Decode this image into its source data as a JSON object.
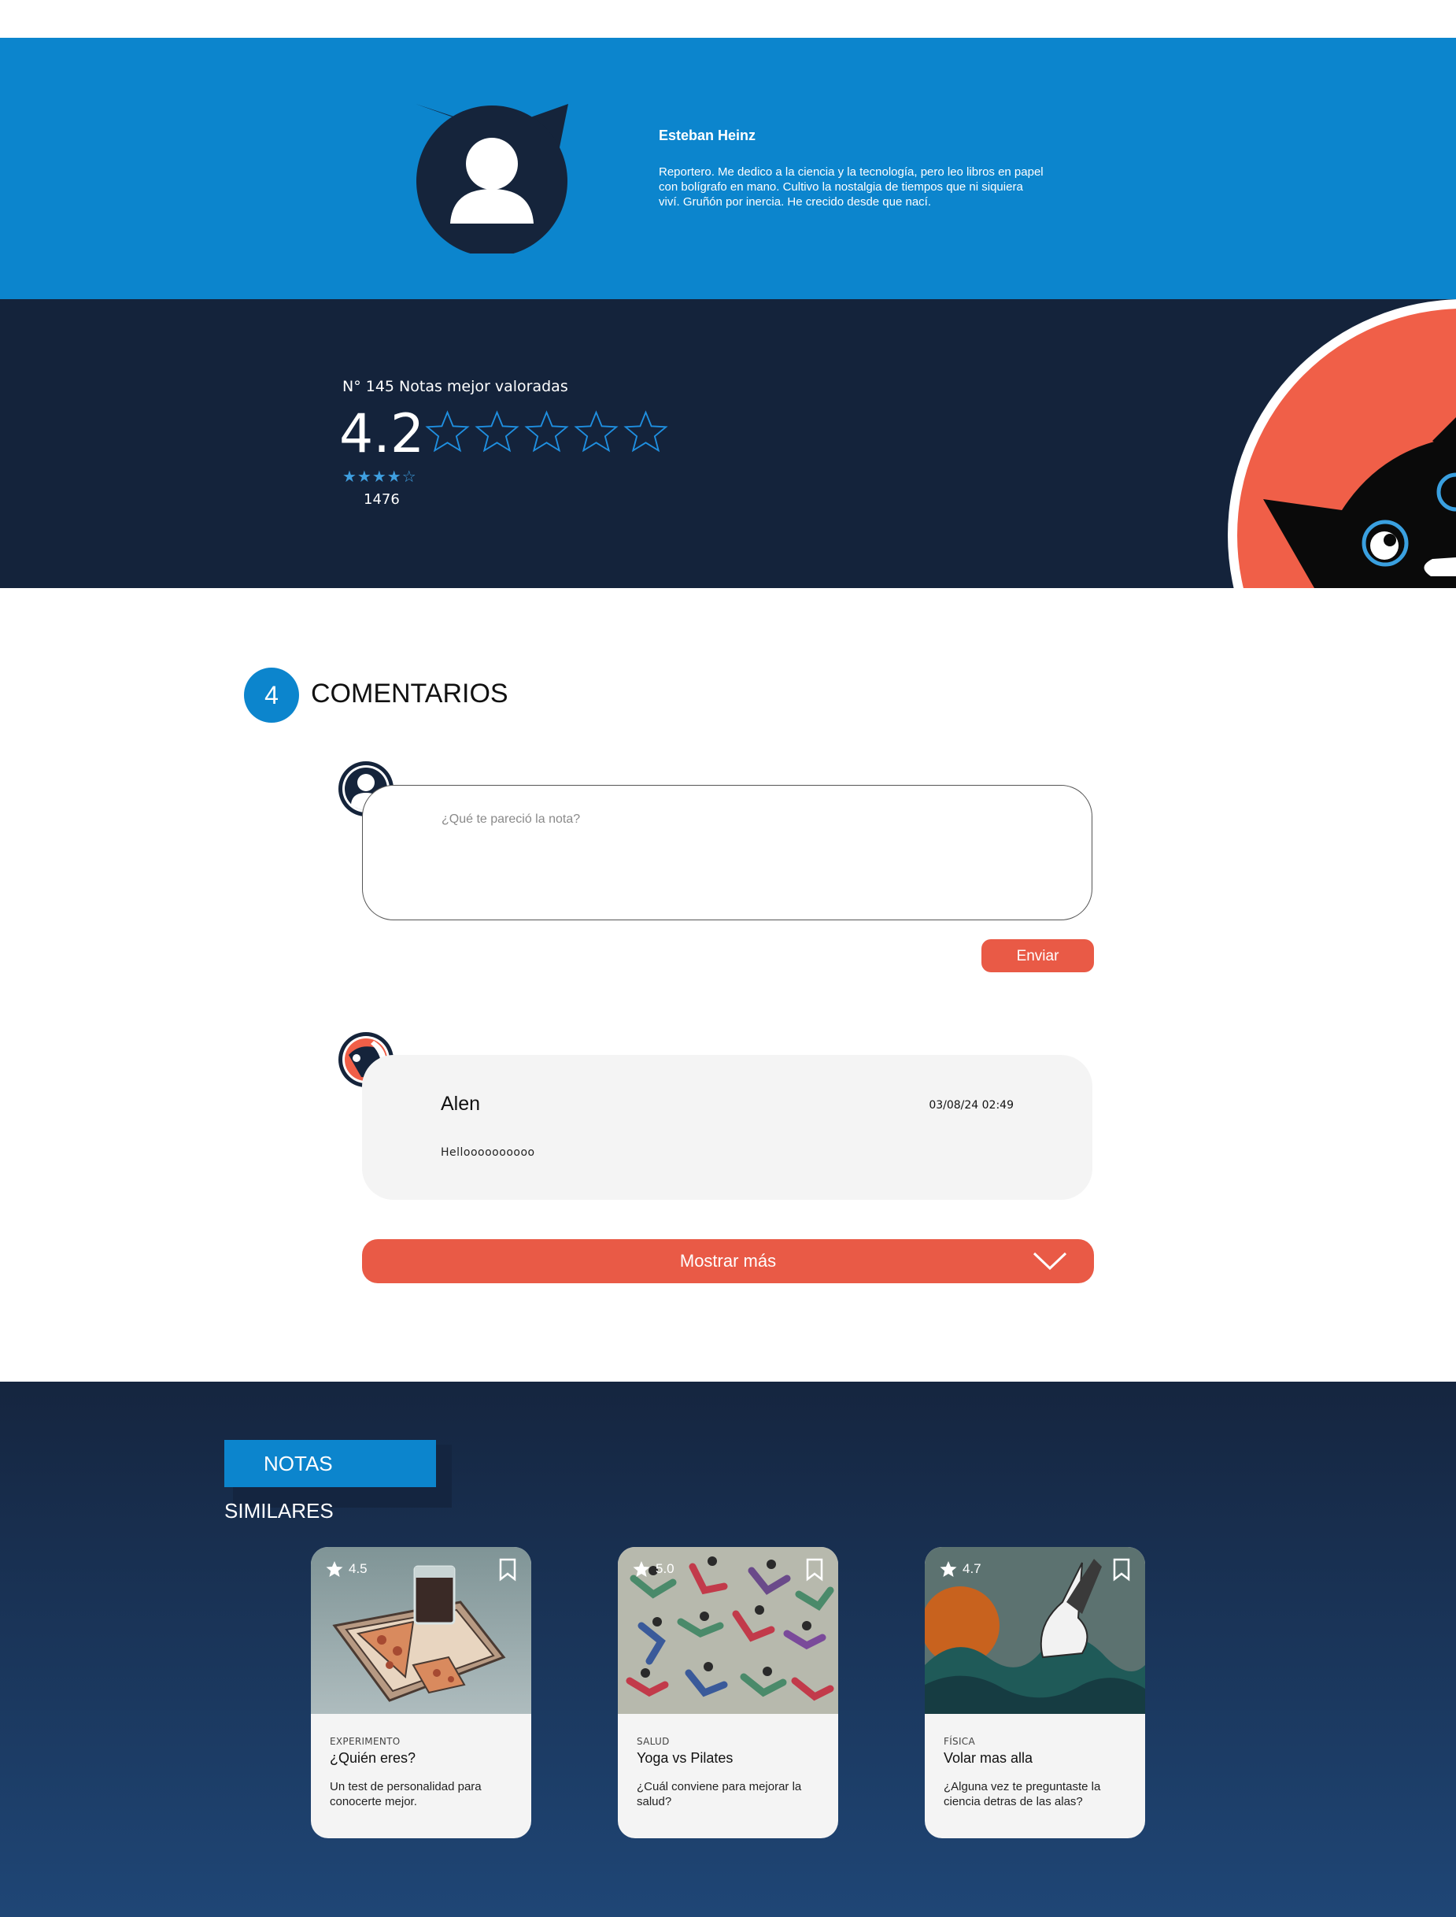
{
  "author": {
    "name": "Esteban Heinz",
    "bio": "Reportero. Me dedico a la ciencia y la tecnología, pero leo libros en papel con bolígrafo en mano. Cultivo la nostalgia de tiempos que ni siquiera viví. Gruñón por inercia. He crecido desde que nací."
  },
  "rating": {
    "label": "N° 145 Notas mejor valoradas",
    "value": "4.2",
    "rating_stars_filled": 0,
    "rating_stars_total": 5,
    "small_stars": "★★★★☆",
    "votes": "1476"
  },
  "comments": {
    "count": "4",
    "title": "COMENTARIOS",
    "composer_placeholder": "¿Qué te pareció la nota?",
    "send_label": "Enviar",
    "items": [
      {
        "author": "Alen",
        "date": "03/08/24 02:49",
        "text": "Helloooooooooo"
      }
    ],
    "show_more_label": "Mostrar más"
  },
  "similar": {
    "title": "NOTAS SIMILARES",
    "cards": [
      {
        "rating": "4.5",
        "category": "EXPERIMENTO",
        "title": "¿Quién eres?",
        "description": "Un test de personalidad para conocerte mejor.",
        "image": "pizza-and-drink-illustration"
      },
      {
        "rating": "5.0",
        "category": "SALUD",
        "title": "Yoga vs Pilates",
        "description": "¿Cuál conviene para mejorar la salud?",
        "image": "yoga-people-pattern-illustration"
      },
      {
        "rating": "4.7",
        "category": "FÍSICA",
        "title": "Volar mas alla",
        "description": "¿Alguna vez te preguntaste la ciencia detras de las alas?",
        "image": "seagull-waves-sunset-illustration"
      }
    ]
  },
  "colors": {
    "primary_blue": "#0c85cd",
    "navy": "#14233b",
    "accent_coral": "#e95a46",
    "card_bg": "#f4f4f4"
  },
  "icons": [
    "cat-avatar-icon",
    "star-outline-icon",
    "user-avatar-icon",
    "chevron-down-icon",
    "star-icon",
    "bookmark-icon"
  ]
}
